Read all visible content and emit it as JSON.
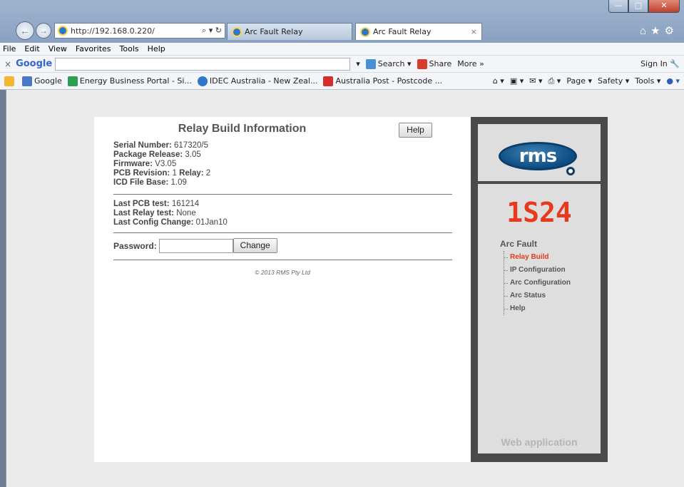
{
  "browser": {
    "address": "http://192.168.0.220/",
    "address_host_bold": "192.168.0.220",
    "tabs": [
      {
        "label": "Arc Fault Relay"
      },
      {
        "label": "Arc Fault Relay"
      }
    ],
    "menu": [
      "File",
      "Edit",
      "View",
      "Favorites",
      "Tools",
      "Help"
    ],
    "google": {
      "logo": "Google",
      "search_label": "Search",
      "share_label": "Share",
      "more_label": "More »",
      "signin_label": "Sign In"
    },
    "favorites": [
      "Google",
      "Energy Business Portal - Si...",
      "IDEC Australia - New Zeal...",
      "Australia Post - Postcode ..."
    ],
    "commands": [
      "Page",
      "Safety",
      "Tools"
    ]
  },
  "page": {
    "title": "Relay Build Information",
    "help_button": "Help",
    "build_info": [
      {
        "label": "Serial Number:",
        "value": "617320/5"
      },
      {
        "label": "Package Release:",
        "value": "3.05"
      },
      {
        "label": "Firmware:",
        "value": "V3.05"
      },
      {
        "label": "PCB Revision:",
        "value": "1",
        "label2": "Relay:",
        "value2": "2"
      },
      {
        "label": "ICD File Base:",
        "value": "1.09"
      }
    ],
    "test_info": [
      {
        "label": "Last PCB test:",
        "value": "161214"
      },
      {
        "label": "Last Relay test:",
        "value": "None"
      },
      {
        "label": "Last Config Change:",
        "value": "01Jan10"
      }
    ],
    "password_label": "Password:",
    "password_value": "",
    "change_button": "Change",
    "copyright": "© 2013 RMS Pty Ltd"
  },
  "sidebar": {
    "logo_text": "rms",
    "model": "1S24",
    "menu_title": "Arc Fault",
    "items": [
      {
        "label": "Relay Build"
      },
      {
        "label": "IP Configuration"
      },
      {
        "label": "Arc Configuration"
      },
      {
        "label": "Arc Status"
      },
      {
        "label": "Help"
      }
    ],
    "footer": "Web application"
  },
  "colors": {
    "accent_red": "#e8381e",
    "logo_blue": "#0c4c84",
    "side_frame": "#4a4a4a"
  }
}
